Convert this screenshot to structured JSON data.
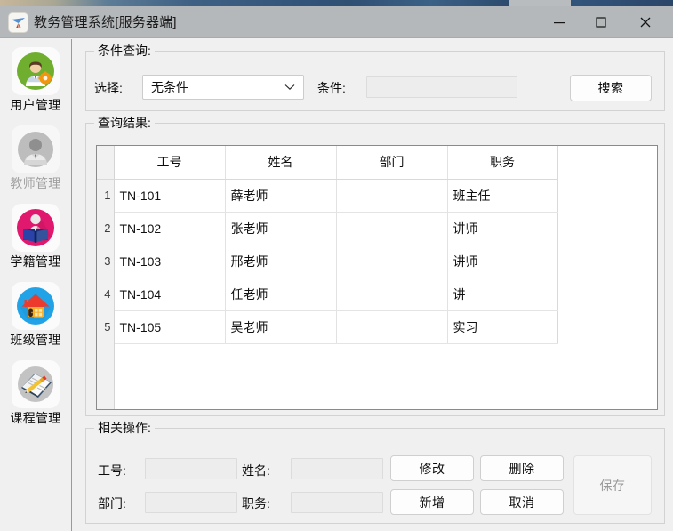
{
  "window": {
    "title": "教务管理系统[服务器端]",
    "icon": "app-logo-icon",
    "controls": {
      "minimize": "minimize-icon",
      "maximize": "maximize-icon",
      "close": "close-icon"
    },
    "titlebar_color": "#b4b8ba"
  },
  "sidebar": {
    "items": [
      {
        "label": "用户管理",
        "icon": "user-gear-icon",
        "enabled": true,
        "color": "#6fae2e"
      },
      {
        "label": "教师管理",
        "icon": "teacher-avatar-icon",
        "enabled": false,
        "color": "#b8b8b8"
      },
      {
        "label": "学籍管理",
        "icon": "student-book-icon",
        "enabled": true,
        "color": "#e0196e"
      },
      {
        "label": "班级管理",
        "icon": "house-icon",
        "enabled": true,
        "color": "#22a3e8"
      },
      {
        "label": "课程管理",
        "icon": "notebook-pencil-icon",
        "enabled": true,
        "color": "#b9b9b9"
      }
    ]
  },
  "query_panel": {
    "title": "条件查询:",
    "select_label": "选择:",
    "select_value": "无条件",
    "select_options": [
      "无条件"
    ],
    "condition_label": "条件:",
    "condition_value": "",
    "condition_placeholder": "",
    "search_button": "搜索"
  },
  "results_panel": {
    "title": "查询结果:",
    "columns": [
      "工号",
      "姓名",
      "部门",
      "职务"
    ],
    "rows": [
      {
        "num": "1",
        "工号": "TN-101",
        "姓名": "薛老师",
        "部门": "",
        "职务": "班主任"
      },
      {
        "num": "2",
        "工号": "TN-102",
        "姓名": "张老师",
        "部门": "",
        "职务": "讲师"
      },
      {
        "num": "3",
        "工号": "TN-103",
        "姓名": "邢老师",
        "部门": "",
        "职务": "讲师"
      },
      {
        "num": "4",
        "工号": "TN-104",
        "姓名": "任老师",
        "部门": "",
        "职务": "讲"
      },
      {
        "num": "5",
        "工号": "TN-105",
        "姓名": "吴老师",
        "部门": "",
        "职务": "实习"
      }
    ]
  },
  "ops_panel": {
    "title": "相关操作:",
    "fields": {
      "id_label": "工号:",
      "id_value": "",
      "name_label": "姓名:",
      "name_value": "",
      "dept_label": "部门:",
      "dept_value": "",
      "title_label": "职务:",
      "title_value": ""
    },
    "buttons": {
      "modify": "修改",
      "delete": "删除",
      "add": "新增",
      "cancel": "取消",
      "save": "保存",
      "save_enabled": false
    }
  }
}
